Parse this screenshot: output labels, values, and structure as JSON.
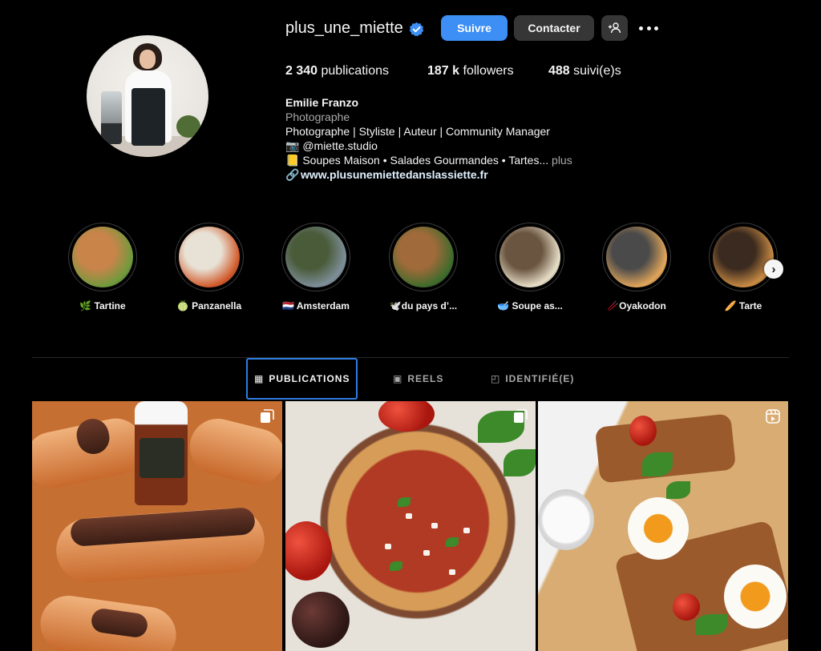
{
  "profile": {
    "username": "plus_une_miette",
    "follow_label": "Suivre",
    "contact_label": "Contacter",
    "add_user_icon": "add-person-icon",
    "more_icon": "more-dots-icon"
  },
  "stats": {
    "posts_count": "2 340",
    "posts_label": "publications",
    "followers_count": "187 k",
    "followers_label": "followers",
    "following_count": "488",
    "following_label": "suivi(e)s"
  },
  "bio": {
    "name": "Emilie Franzo",
    "category": "Photographe",
    "line1": "Photographe | Styliste | Auteur | Community Manager",
    "line2": "📷 @miette.studio",
    "line3": "📒 Soupes Maison • Salades Gourmandes • Tartes...",
    "more_label": "plus",
    "link": "www.plusunemiettedanslassiette.fr"
  },
  "highlights": [
    {
      "label": "🌿 Tartine",
      "color_a": "#6f9a3d",
      "color_b": "#c9844a"
    },
    {
      "label": "🍈 Panzanella",
      "color_a": "#d05a2a",
      "color_b": "#e8e2d6"
    },
    {
      "label": "🇳🇱 Amsterdam",
      "color_a": "#7e8f9a",
      "color_b": "#4a5b3a"
    },
    {
      "label": "🕊️du pays d’...",
      "color_a": "#3e6b2c",
      "color_b": "#a06a3a"
    },
    {
      "label": "🥣 Soupe as...",
      "color_a": "#e8dfc8",
      "color_b": "#6a5540"
    },
    {
      "label": "🥢Oyakodon",
      "color_a": "#e2a65a",
      "color_b": "#4b4a4a"
    },
    {
      "label": "🥖 Tarte",
      "color_a": "#c98b43",
      "color_b": "#3b2a1f"
    }
  ],
  "tabs": {
    "publications": "PUBLICATIONS",
    "reels": "REELS",
    "tagged": "IDENTIFIÉ(E)"
  },
  "colors": {
    "accent": "#3d8ef5",
    "background": "#000000",
    "secondary_button": "#363636",
    "verified": "#3d8ef5"
  }
}
